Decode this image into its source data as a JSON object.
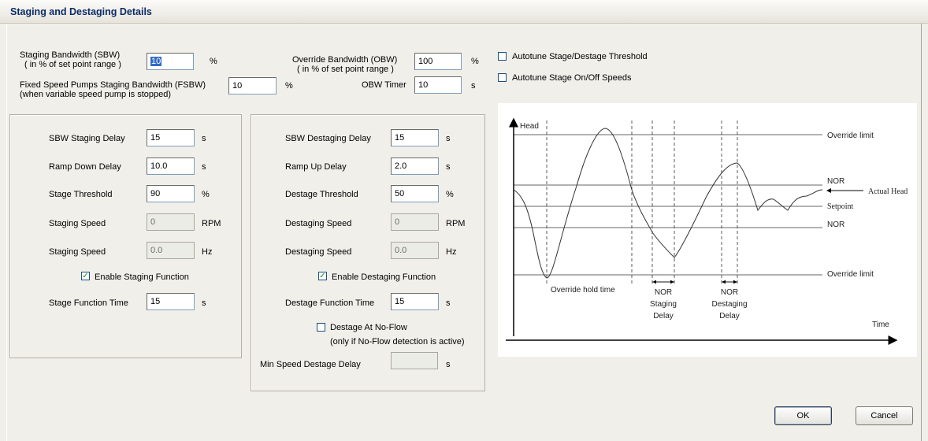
{
  "window": {
    "title": "Staging and Destaging Details"
  },
  "top": {
    "sbw_label": "Staging Bandwidth (SBW)",
    "sbw_sub": "( in % of set point range )",
    "sbw_value": "10",
    "sbw_unit": "%",
    "fsbw_label": "Fixed Speed Pumps Staging Bandwidth (FSBW)",
    "fsbw_sub": "(when variable speed pump is stopped)",
    "fsbw_value": "10",
    "fsbw_unit": "%",
    "obw_label": "Override Bandwidth (OBW)",
    "obw_sub": "( in % of set point range )",
    "obw_value": "100",
    "obw_unit": "%",
    "obw_timer_label": "OBW Timer",
    "obw_timer_value": "10",
    "obw_timer_unit": "s",
    "autotune_threshold": {
      "label": "Autotune Stage/Destage Threshold",
      "checked": false
    },
    "autotune_speeds": {
      "label": "Autotune Stage On/Off Speeds",
      "checked": false
    }
  },
  "staging": {
    "sbw_delay": {
      "label": "SBW Staging Delay",
      "value": "15",
      "unit": "s"
    },
    "ramp_down": {
      "label": "Ramp Down Delay",
      "value": "10.0",
      "unit": "s"
    },
    "threshold": {
      "label": "Stage Threshold",
      "value": "90",
      "unit": "%"
    },
    "speed_rpm": {
      "label": "Staging Speed",
      "value": "0",
      "unit": "RPM"
    },
    "speed_hz": {
      "label": "Staging Speed",
      "value": "0.0",
      "unit": "Hz"
    },
    "enable": {
      "label": "Enable Staging Function",
      "checked": true
    },
    "function_time": {
      "label": "Stage Function Time",
      "value": "15",
      "unit": "s"
    }
  },
  "destaging": {
    "sbw_delay": {
      "label": "SBW Destaging Delay",
      "value": "15",
      "unit": "s"
    },
    "ramp_up": {
      "label": "Ramp Up Delay",
      "value": "2.0",
      "unit": "s"
    },
    "threshold": {
      "label": "Destage Threshold",
      "value": "50",
      "unit": "%"
    },
    "speed_rpm": {
      "label": "Destaging Speed",
      "value": "0",
      "unit": "RPM"
    },
    "speed_hz": {
      "label": "Destaging Speed",
      "value": "0.0",
      "unit": "Hz"
    },
    "enable": {
      "label": "Enable Destaging Function",
      "checked": true
    },
    "function_time": {
      "label": "Destage Function Time",
      "value": "15",
      "unit": "s"
    },
    "no_flow": {
      "label": "Destage At No-Flow",
      "sub": "(only if No-Flow detection is active)",
      "checked": false
    },
    "min_speed_delay": {
      "label": "Min Speed Destage Delay",
      "value": "",
      "unit": "s"
    }
  },
  "diagram": {
    "y_axis": "Head",
    "x_axis": "Time",
    "override_limit_top": "Override limit",
    "nor_top": "NOR",
    "actual_head": "Actual Head",
    "setpoint": "Setpoint",
    "nor_bottom": "NOR",
    "override_limit_bottom": "Override limit",
    "override_hold_time": "Override hold time",
    "nor_staging": [
      "NOR",
      "Staging",
      "Delay"
    ],
    "nor_destaging": [
      "NOR",
      "Destaging",
      "Delay"
    ]
  },
  "buttons": {
    "ok": "OK",
    "cancel": "Cancel"
  }
}
